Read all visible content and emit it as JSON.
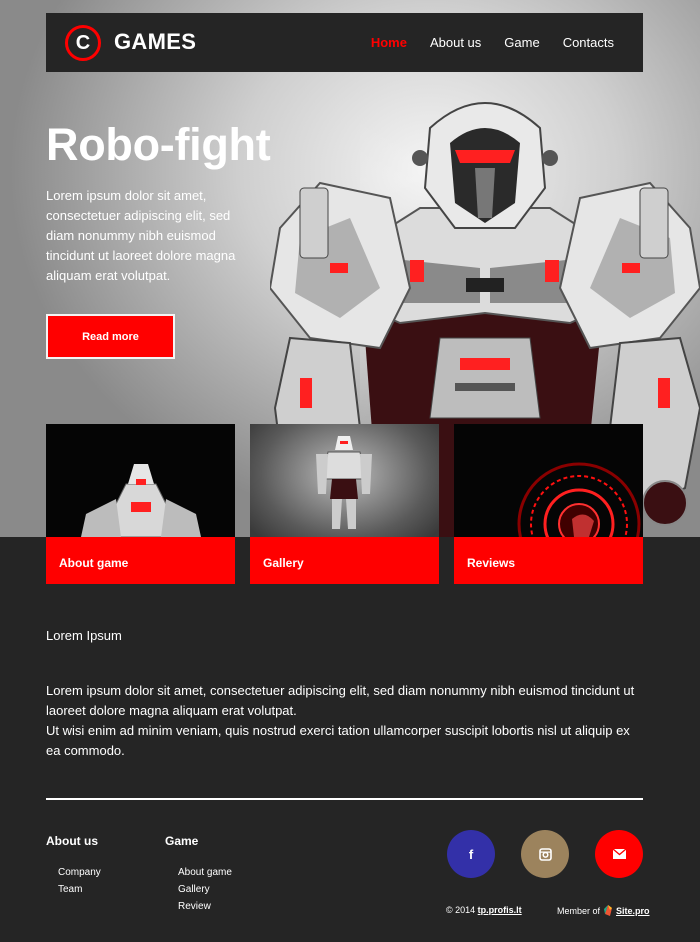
{
  "brand": {
    "logo_letter": "C",
    "name": "GAMES"
  },
  "nav": {
    "items": [
      {
        "label": "Home",
        "active": true
      },
      {
        "label": "About us",
        "active": false
      },
      {
        "label": "Game",
        "active": false
      },
      {
        "label": "Contacts",
        "active": false
      }
    ]
  },
  "hero": {
    "title": "Robo-fight",
    "text": "Lorem ipsum dolor sit amet, consectetuer adipiscing elit, sed diam nonummy nibh euismod tincidunt ut laoreet dolore magna aliquam erat volutpat.",
    "button": "Read more"
  },
  "cards": [
    {
      "label": "About game"
    },
    {
      "label": "Gallery"
    },
    {
      "label": "Reviews"
    }
  ],
  "content": {
    "title": "Lorem Ipsum",
    "paragraph1": "Lorem ipsum dolor sit amet, consectetuer adipiscing elit, sed diam nonummy nibh euismod tincidunt ut laoreet dolore magna aliquam erat volutpat.",
    "paragraph2": "Ut wisi enim ad minim veniam, quis nostrud exerci tation ullamcorper suscipit lobortis nisl ut aliquip ex ea commodo."
  },
  "footer": {
    "about": {
      "title": "About us",
      "links": [
        "Company",
        "Team"
      ]
    },
    "game": {
      "title": "Game",
      "links": [
        "About game",
        "Gallery",
        "Review"
      ]
    },
    "social": [
      {
        "icon": "facebook-icon",
        "glyph": "f",
        "color": "#3330a8"
      },
      {
        "icon": "instagram-icon",
        "color": "#9c835d"
      },
      {
        "icon": "mail-icon",
        "color": "#ff0000"
      }
    ],
    "copyright_prefix": "© 2014",
    "copyright_link": "tp.profis.lt",
    "member_prefix": "Member of",
    "member_link": "Site.pro"
  },
  "colors": {
    "accent": "#ff0000",
    "dark": "#252525"
  }
}
